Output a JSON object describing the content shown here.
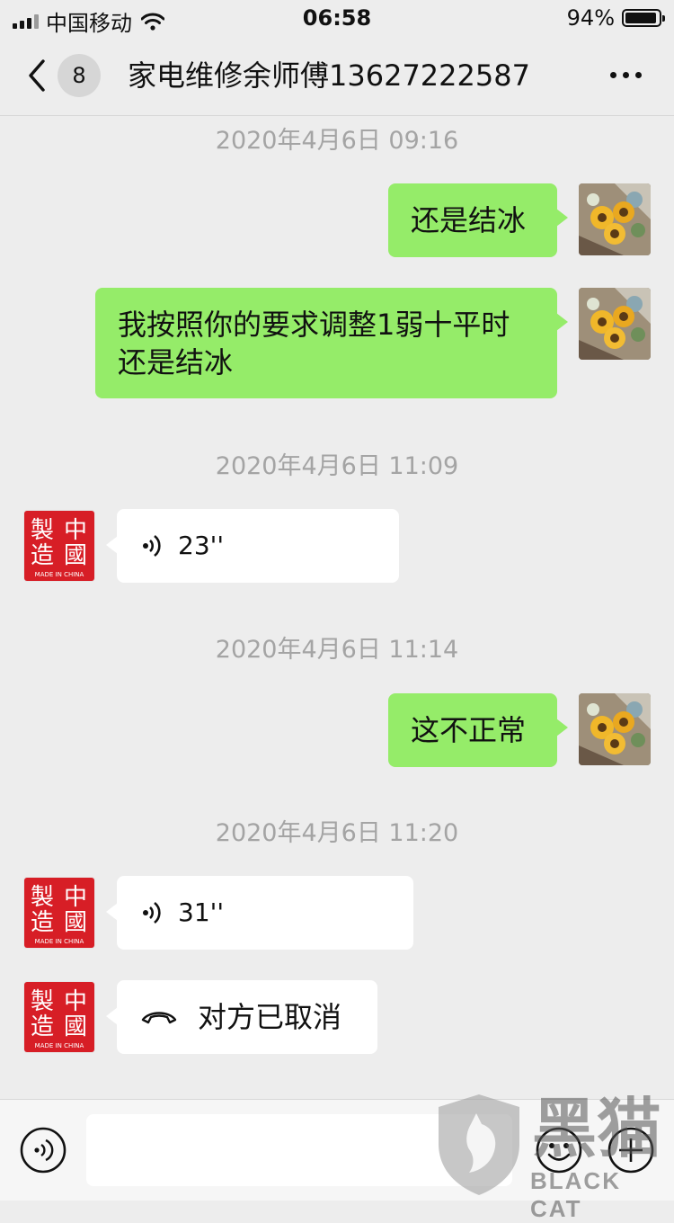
{
  "status_bar": {
    "carrier": "中国移动",
    "time": "06:58",
    "battery_percent": "94%",
    "battery_level": 0.94
  },
  "nav": {
    "unread_count": "8",
    "title": "家电维修余师傅13627222587"
  },
  "messages": {
    "ts1": "2020年4月6日 09:16",
    "m1": "还是结冰",
    "m2_line1": "我按照你的要求调整1弱十平时",
    "m2_line2": "还是结冰",
    "ts2": "2020年4月6日 11:09",
    "voice1": "23''",
    "ts3": "2020年4月6日 11:14",
    "m3": "这不正常",
    "ts4": "2020年4月6日 11:20",
    "voice2": "31''",
    "call": "对方已取消"
  },
  "avatar_made_in_china": {
    "char1": "製",
    "char2": "中",
    "char3": "造",
    "char4": "國",
    "caption": "MADE IN CHINA"
  },
  "watermark": {
    "text": "BLACK CAT",
    "chars": "黑猫"
  },
  "icons": {
    "back": "chevron-left-icon",
    "more": "more-dots-icon",
    "voice": "voice-wave-icon",
    "phone": "phone-hangup-icon",
    "voice_input": "voice-input-icon",
    "emoji": "emoji-icon",
    "add": "plus-icon"
  }
}
